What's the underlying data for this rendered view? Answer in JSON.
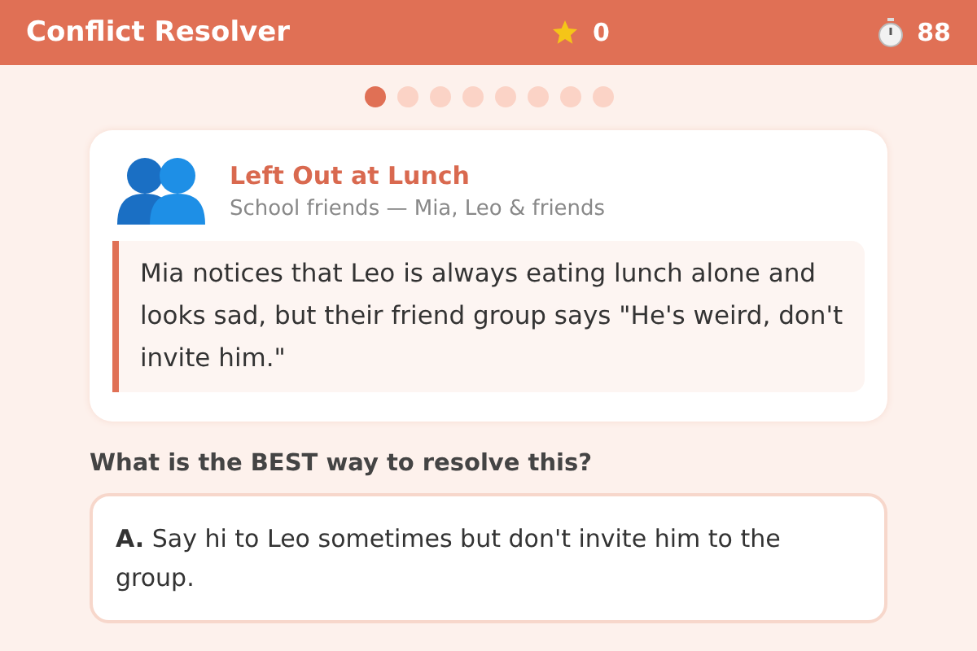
{
  "header": {
    "title": "Conflict Resolver",
    "score": "0",
    "time": "88"
  },
  "progress": [
    {
      "selected": true
    },
    {
      "selected": false
    },
    {
      "selected": false
    },
    {
      "selected": false
    },
    {
      "selected": false
    },
    {
      "selected": false
    },
    {
      "selected": false
    },
    {
      "selected": false
    }
  ],
  "scenario": {
    "title": "Left Out at Lunch",
    "subtitle": "School friends — Mia, Leo & friends",
    "text": "Mia notices that Leo is always eating lunch alone and looks sad, but their friend group says \"He's weird, don't invite him.\""
  },
  "question": "What is the BEST way to resolve this?",
  "options": [
    {
      "text": "**A.** Say hi to Leo sometimes but don't invite him to the group."
    }
  ]
}
